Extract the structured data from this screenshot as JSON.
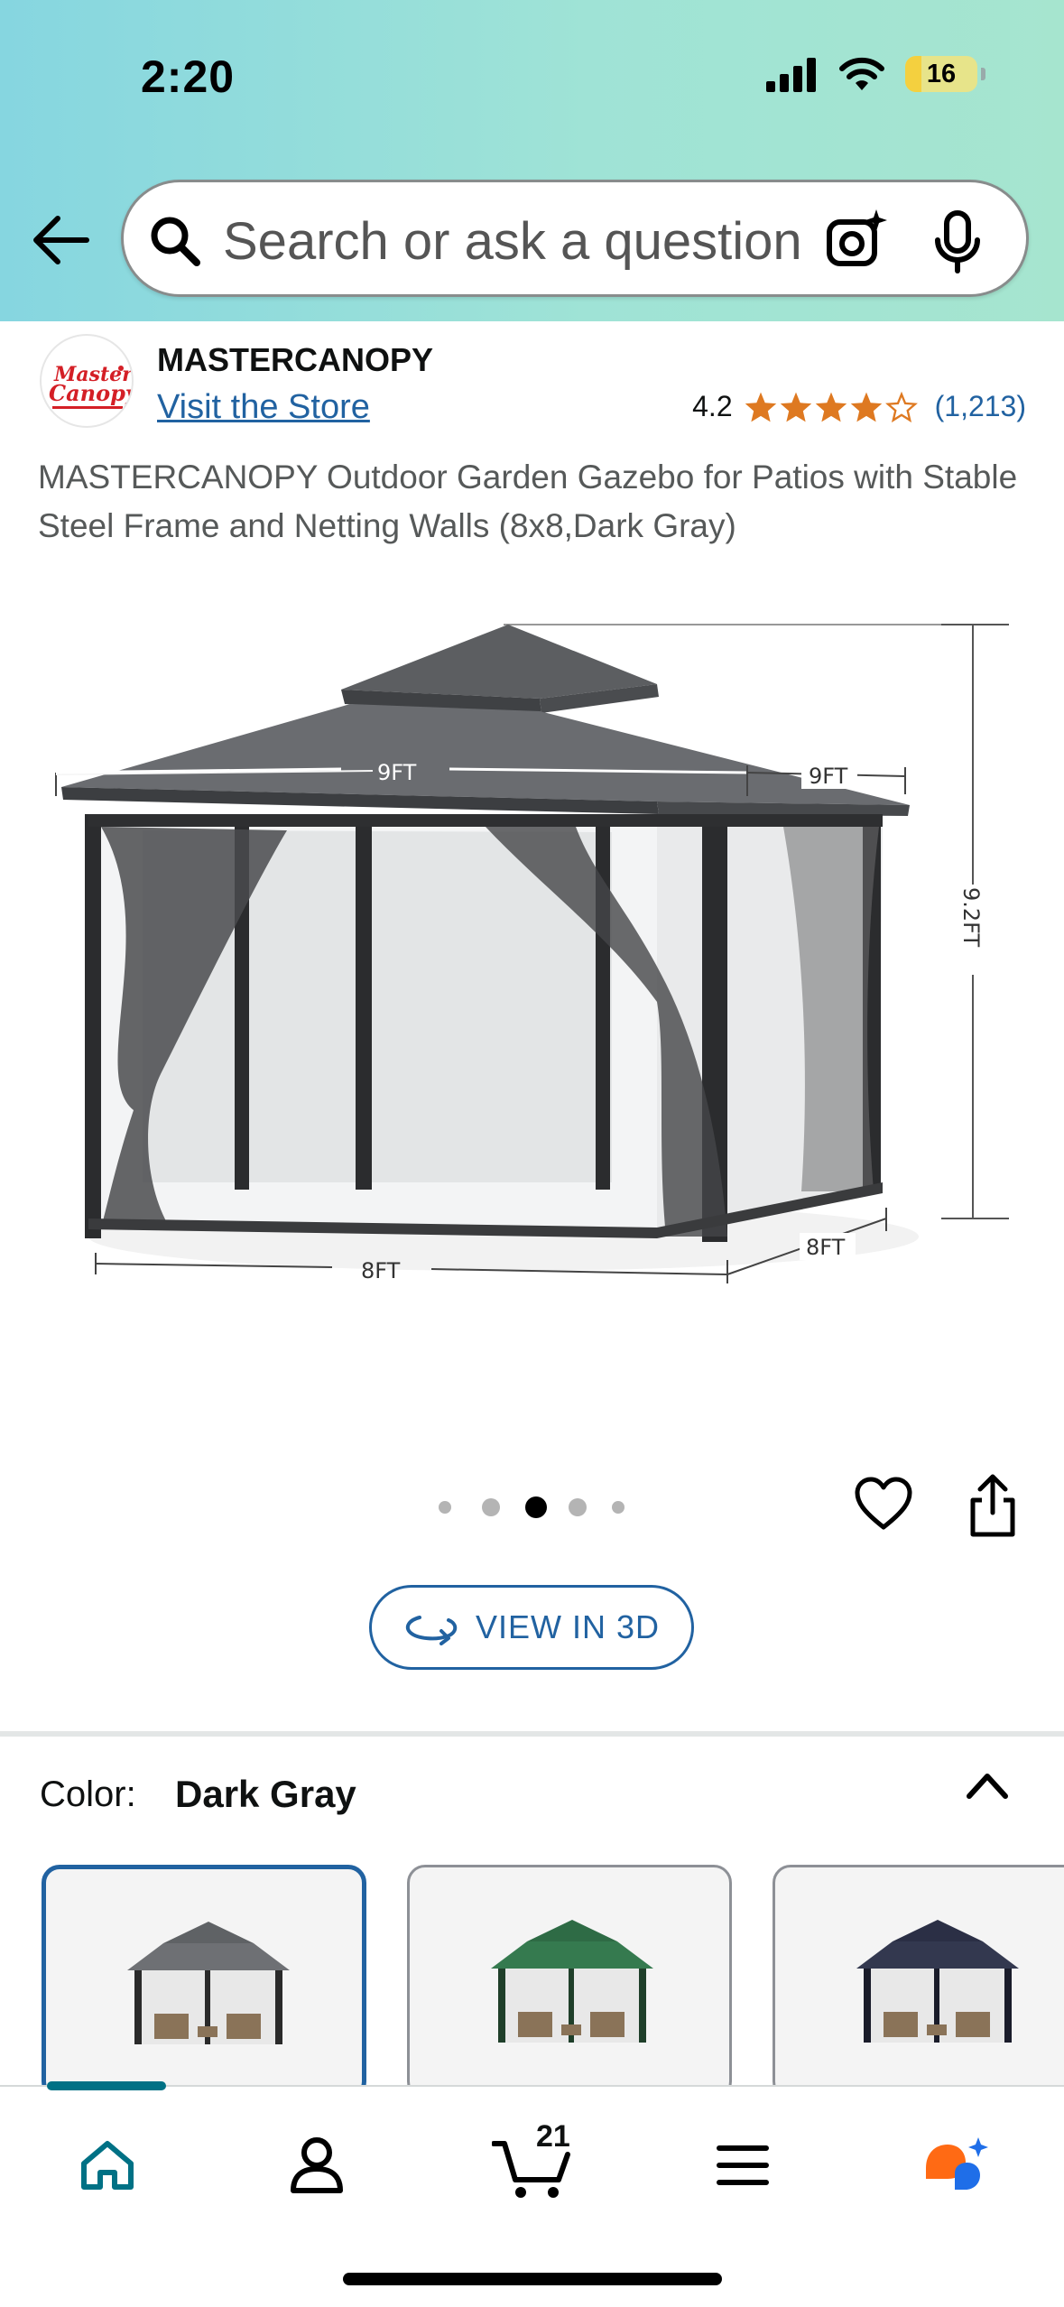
{
  "status_bar": {
    "time": "2:20",
    "battery_level": "16"
  },
  "search": {
    "placeholder": "Search or ask a question",
    "icons": [
      "back-arrow-icon",
      "search-icon",
      "camera-icon",
      "microphone-icon"
    ]
  },
  "brand": {
    "name": "MASTERCANOPY",
    "visit_store_label": "Visit the Store",
    "logo_text": "MasterCanopy"
  },
  "rating": {
    "value": "4.2",
    "stars_filled": 4,
    "stars_total": 5,
    "review_count": "(1,213)",
    "star_color": "#de7921"
  },
  "product": {
    "title": "MASTERCANOPY Outdoor Garden Gazebo for Patios with Stable Steel Frame and Netting Walls (8x8,Dark Gray)",
    "image_dimension_labels": {
      "roof_front": "9FT",
      "roof_side": "9FT",
      "height": "9.2FT",
      "base_front": "8FT",
      "base_side": "8FT"
    }
  },
  "carousel": {
    "dot_count": 5,
    "active_index": 2
  },
  "view_3d": {
    "label": "VIEW IN 3D"
  },
  "color_selector": {
    "label": "Color:",
    "selected": "Dark Gray",
    "swatches": [
      {
        "color": "#5f6265",
        "selected": true
      },
      {
        "color": "#2e6b45",
        "selected": false
      },
      {
        "color": "#2b2f45",
        "selected": false
      }
    ]
  },
  "bottom_nav": {
    "items": [
      "home-icon",
      "account-icon",
      "cart-icon",
      "menu-icon",
      "rufus-icon"
    ],
    "cart_count": "21",
    "accent": "#007185"
  },
  "colors": {
    "link": "#2162a1",
    "header_gradient_start": "#86d6e0",
    "header_gradient_end": "#a6e5cf"
  }
}
